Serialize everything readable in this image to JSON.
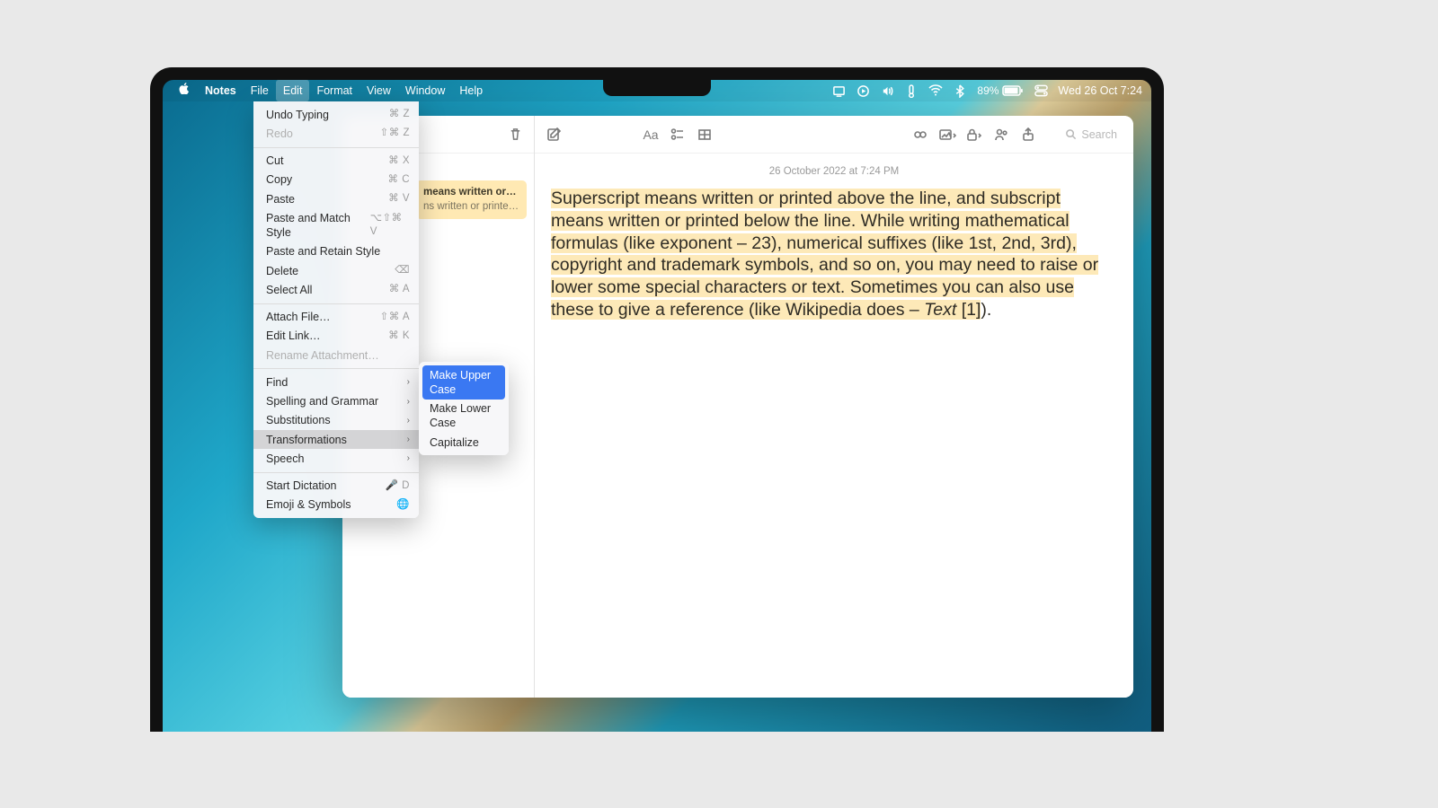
{
  "menubar": {
    "app": "Notes",
    "items": [
      "File",
      "Edit",
      "Format",
      "View",
      "Window",
      "Help"
    ],
    "active": "Edit",
    "battery_pct": "89%",
    "clock": "Wed 26 Oct  7:24"
  },
  "edit_menu": {
    "undo": {
      "label": "Undo Typing",
      "shortcut": "⌘ Z"
    },
    "redo": {
      "label": "Redo",
      "shortcut": "⇧⌘ Z"
    },
    "cut": {
      "label": "Cut",
      "shortcut": "⌘ X"
    },
    "copy": {
      "label": "Copy",
      "shortcut": "⌘ C"
    },
    "paste": {
      "label": "Paste",
      "shortcut": "⌘ V"
    },
    "paste_match": {
      "label": "Paste and Match Style",
      "shortcut": "⌥⇧⌘ V"
    },
    "paste_retain": {
      "label": "Paste and Retain Style",
      "shortcut": ""
    },
    "delete": {
      "label": "Delete",
      "shortcut": "⌫"
    },
    "select_all": {
      "label": "Select All",
      "shortcut": "⌘ A"
    },
    "attach": {
      "label": "Attach File…",
      "shortcut": "⇧⌘ A"
    },
    "edit_link": {
      "label": "Edit Link…",
      "shortcut": "⌘ K"
    },
    "rename": {
      "label": "Rename Attachment…",
      "shortcut": ""
    },
    "find": {
      "label": "Find"
    },
    "spelling": {
      "label": "Spelling and Grammar"
    },
    "subst": {
      "label": "Substitutions"
    },
    "transform": {
      "label": "Transformations"
    },
    "speech": {
      "label": "Speech"
    },
    "dictation": {
      "label": "Start Dictation",
      "shortcut": "🎤 D"
    },
    "emoji": {
      "label": "Emoji & Symbols",
      "shortcut": "🌐"
    }
  },
  "transform_menu": {
    "upper": "Make Upper Case",
    "lower": "Make Lower Case",
    "cap": "Capitalize"
  },
  "sidebar_note": {
    "title": "means written or…",
    "preview": "ns written or printed…"
  },
  "editor": {
    "date": "26 October 2022 at 7:24 PM",
    "body_pre": "Superscript means written or printed above the line, and subscript means written or printed below the line. While writing mathematical formulas (like exponent – 23), numerical suffixes (like 1st, 2nd, 3rd), copyright and trademark symbols, and so on, you may need to raise or lower some special characters or text. Sometimes you can also use these to give a reference (like Wikipedia does – ",
    "body_italic": "Text",
    "body_bracket": " [1]",
    "body_tail": ")."
  },
  "search": {
    "placeholder": "Search"
  }
}
